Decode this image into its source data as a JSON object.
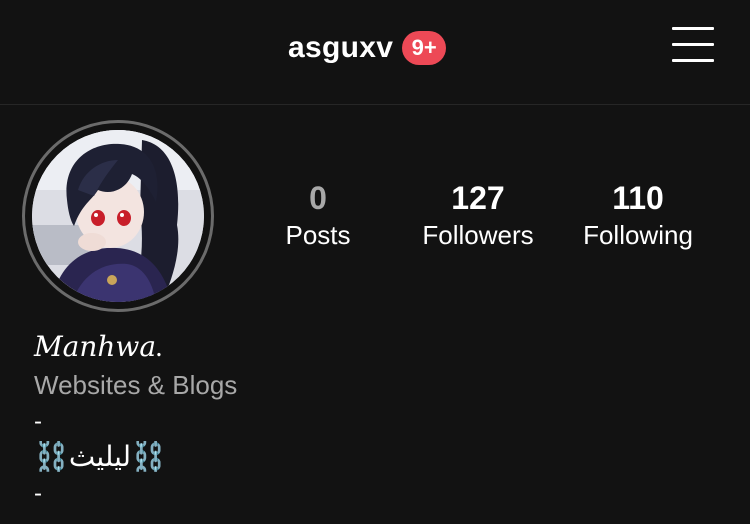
{
  "header": {
    "username": "asguxv",
    "notification_badge": "9+",
    "menu_icon": "hamburger-menu-icon",
    "badge_color": "#ed4956"
  },
  "profile": {
    "avatar_icon": "profile-avatar"
  },
  "stats": {
    "posts_value": "0",
    "posts_label": "Posts",
    "followers_value": "127",
    "followers_label": "Followers",
    "following_value": "110",
    "following_label": "Following"
  },
  "bio": {
    "name": "𝑀𝑎𝑛ℎ𝑤𝑎.",
    "category": "Websites & Blogs",
    "line1": "-",
    "line2": "⛓️ليليث⛓️",
    "line3": "-"
  },
  "colors": {
    "background": "#121212",
    "muted_text": "#a8a8a8"
  }
}
